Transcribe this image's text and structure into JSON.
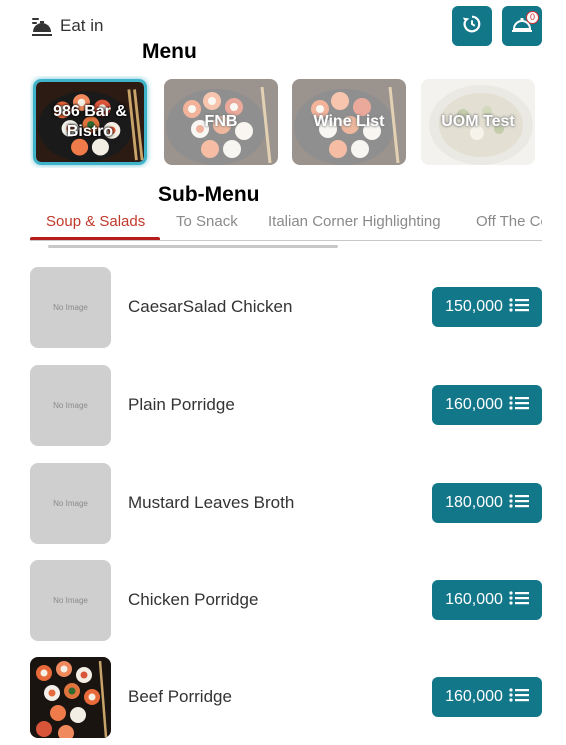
{
  "header": {
    "dine_mode": "Eat in",
    "order_count": "0",
    "history_icon": "history-icon",
    "order_icon": "food-cloche-icon",
    "dine_icon": "serving-icon"
  },
  "annotations": {
    "menu": "Menu",
    "submenu": "Sub-Menu"
  },
  "menus": [
    {
      "label": "986 Bar & Bistro",
      "active": true
    },
    {
      "label": "FNB",
      "active": false
    },
    {
      "label": "Wine List",
      "active": false
    },
    {
      "label": "UOM Test",
      "active": false
    }
  ],
  "tabs": [
    {
      "label": "Soup & Salads",
      "active": true
    },
    {
      "label": "To Snack",
      "active": false
    },
    {
      "label": "Italian Corner Highlighting",
      "active": false
    },
    {
      "label": "Off The Coast",
      "active": false
    }
  ],
  "items": [
    {
      "name": "CaesarSalad Chicken",
      "price": "150,000",
      "image": "No Image"
    },
    {
      "name": "Plain Porridge",
      "price": "160,000",
      "image": "No Image"
    },
    {
      "name": "Mustard Leaves Broth",
      "price": "180,000",
      "image": "No Image"
    },
    {
      "name": "Chicken Porridge",
      "price": "160,000",
      "image": "No Image"
    },
    {
      "name": "Beef Porridge",
      "price": "160,000",
      "image": "sushi-photo"
    }
  ],
  "colors": {
    "accent": "#13778a",
    "active_tab": "#c0392b",
    "active_border": "#3fb3c9"
  }
}
